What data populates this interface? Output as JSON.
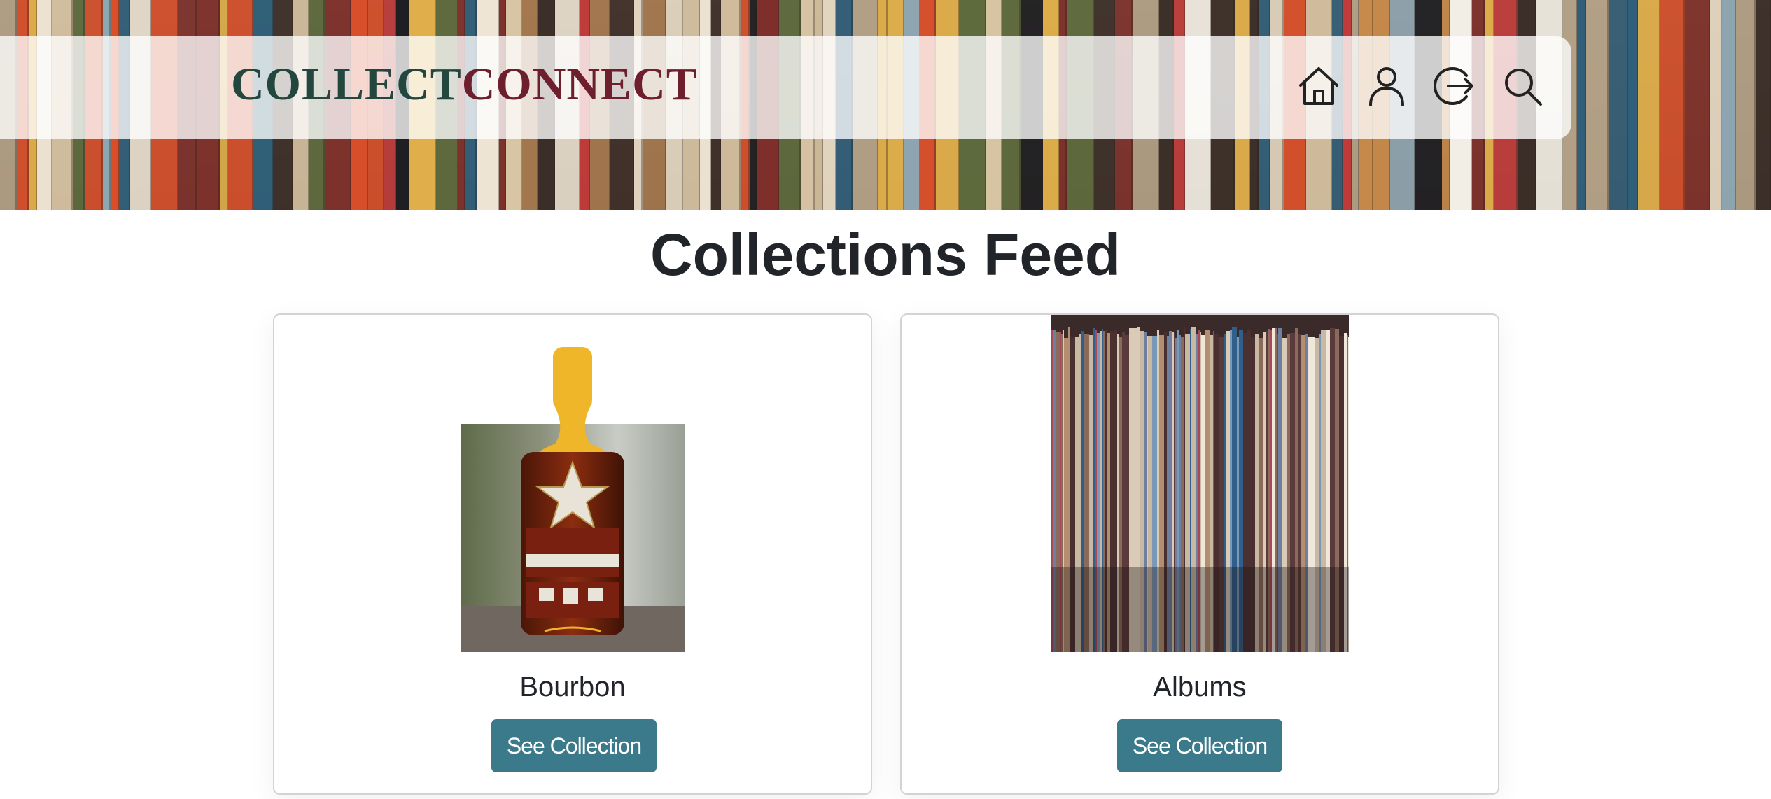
{
  "header": {
    "logo_part_a": "COLLECT",
    "logo_part_b": "CONNECT",
    "nav_icons": [
      "home-icon",
      "user-icon",
      "logout-icon",
      "search-icon"
    ]
  },
  "main": {
    "title": "Collections Feed",
    "cards": [
      {
        "title": "Bourbon",
        "button_label": "See Collection",
        "image": "bourbon-bottle-photo"
      },
      {
        "title": "Albums",
        "button_label": "See Collection",
        "image": "vinyl-records-photo"
      }
    ]
  },
  "colors": {
    "logo_green": "#23473f",
    "logo_maroon": "#6e1f2e",
    "button_teal": "#3b7a8a",
    "title_text": "#212529"
  }
}
